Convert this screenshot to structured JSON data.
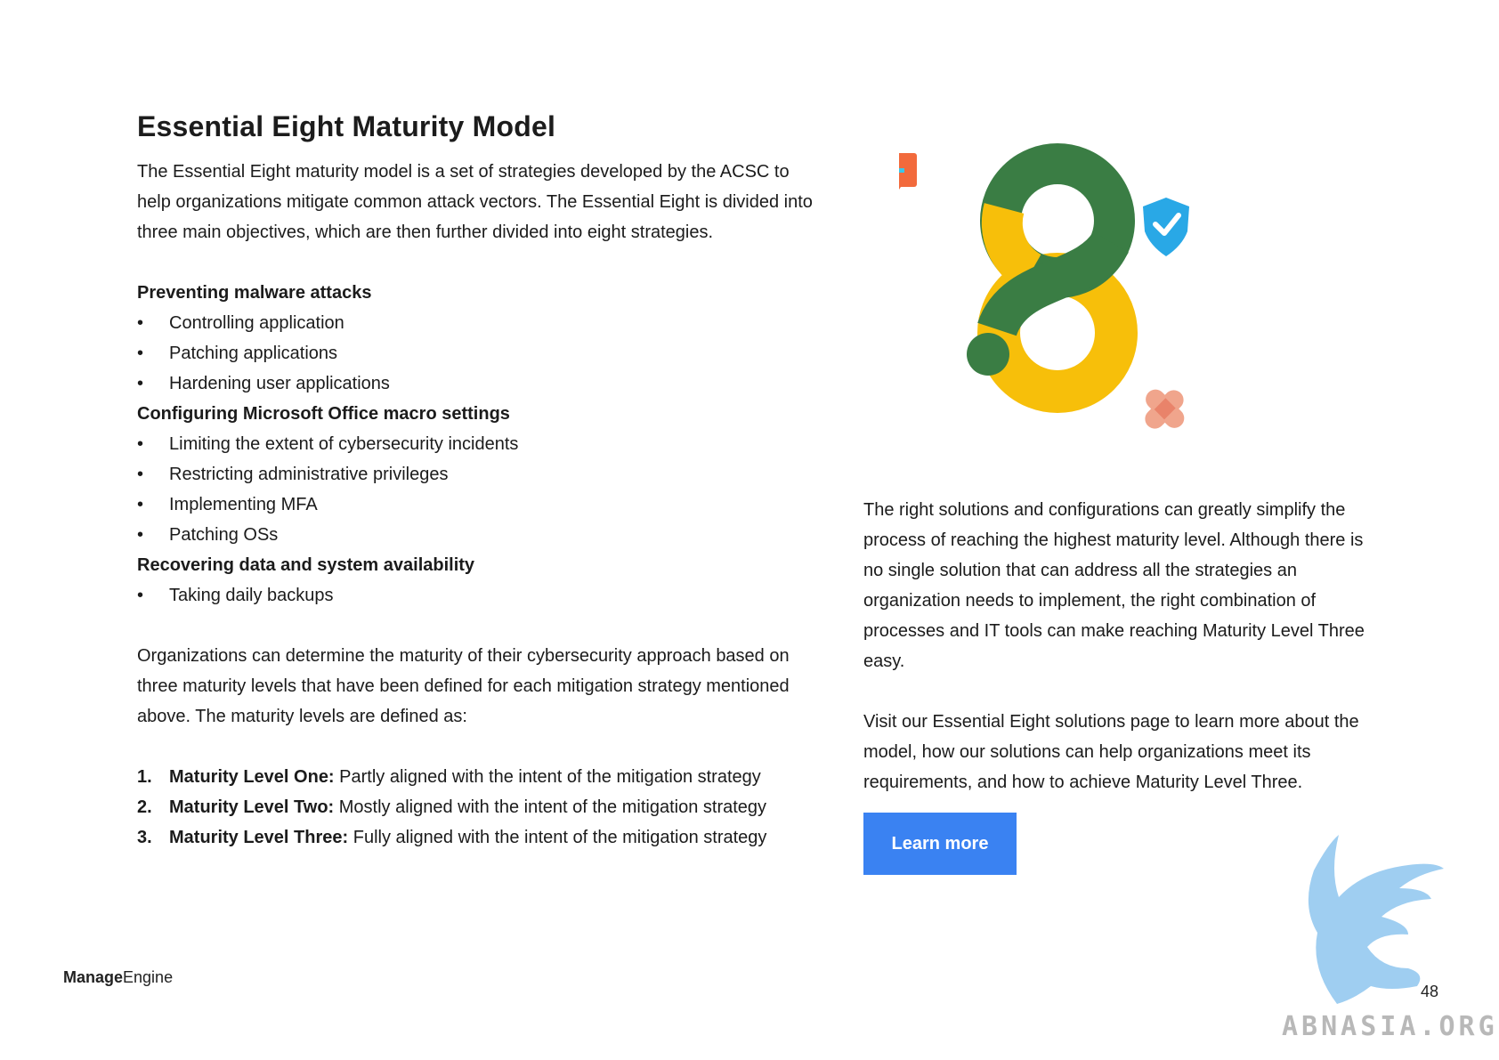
{
  "title": "Essential Eight Maturity Model",
  "intro": "The Essential Eight maturity model is a set of strategies developed by the ACSC to help organizations mitigate common attack vectors. The Essential Eight is divided into three main objectives, which are then further divided into eight strategies.",
  "sections": [
    {
      "heading": "Preventing malware attacks",
      "items": [
        "Controlling application",
        "Patching applications",
        "Hardening user applications"
      ]
    },
    {
      "heading": "Configuring Microsoft Office macro settings",
      "items": [
        "Limiting the extent of cybersecurity incidents",
        "Restricting administrative privileges",
        "Implementing MFA",
        "Patching OSs"
      ]
    },
    {
      "heading": "Recovering data and system availability",
      "items": [
        "Taking daily backups"
      ]
    }
  ],
  "levels_intro": "Organizations can determine the maturity of their cybersecurity approach based on three maturity levels that have been defined for each mitigation strategy mentioned above. The maturity levels are defined as:",
  "levels": [
    {
      "num": "1.",
      "name": "Maturity Level One:",
      "desc": " Partly aligned with the intent of the mitigation strategy"
    },
    {
      "num": "2.",
      "name": "Maturity Level Two:",
      "desc": " Mostly aligned with the intent of the mitigation strategy"
    },
    {
      "num": "3.",
      "name": "Maturity Level Three:",
      "desc": " Fully aligned with the intent of the mitigation strategy"
    }
  ],
  "right_para1": "The right solutions and configurations can greatly simplify the process of reaching the highest maturity level. Although there is no single solution that can address all the strategies an organization needs to implement, the right combination of processes and IT tools can make reaching Maturity Level Three easy.",
  "right_para2": "Visit our Essential Eight solutions page to learn more about the model, how our solutions can help organizations meet its requirements, and how to achieve Maturity Level Three.",
  "cta_label": "Learn more",
  "logo": {
    "part1": "Manage",
    "part2": "Engine"
  },
  "page_number": "48",
  "watermark": "ABNASIA.ORG",
  "colors": {
    "green": "#3a7d44",
    "yellow": "#f7bf0a",
    "button": "#3a82f2"
  },
  "icons": [
    "key-chat-icon",
    "shield-check-icon",
    "badge-check-icon",
    "bandage-icon"
  ]
}
